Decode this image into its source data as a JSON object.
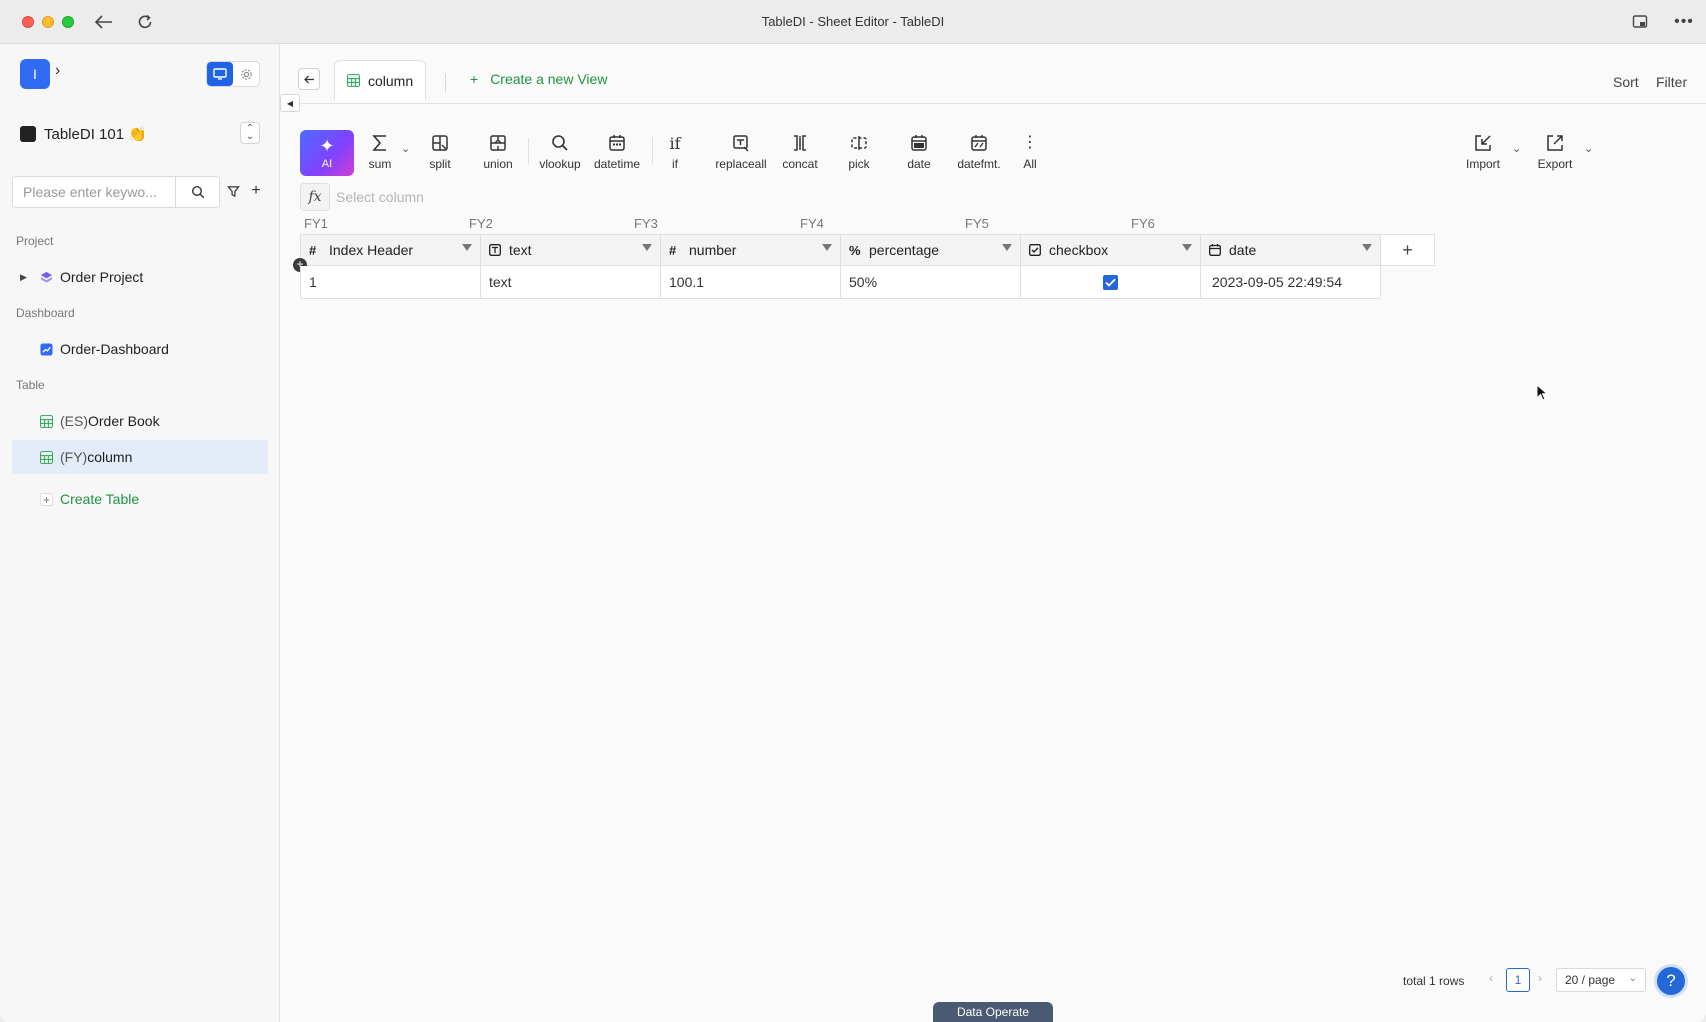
{
  "window": {
    "title": "TableDI - Sheet Editor - TableDI"
  },
  "sidebar": {
    "logo_letter": "I",
    "workspace": {
      "name": "TableDI 101 👏"
    },
    "search": {
      "placeholder": "Please enter keywo..."
    },
    "sections": {
      "project": "Project",
      "dashboard": "Dashboard",
      "table": "Table"
    },
    "items": {
      "order_project": "Order Project",
      "order_dashboard": "Order-Dashboard",
      "order_book": {
        "prefix": "(ES)",
        "label": "Order Book"
      },
      "column": {
        "prefix": "(FY)",
        "label": "column"
      },
      "create_table": "Create Table"
    }
  },
  "tabs": {
    "active": "column",
    "new_view": "Create a new View",
    "sort": "Sort",
    "filter": "Filter"
  },
  "toolbar": {
    "ai": "AI",
    "sum": "sum",
    "split": "split",
    "union": "union",
    "vlookup": "vlookup",
    "datetime": "datetime",
    "if": "if",
    "replaceall": "replaceall",
    "concat": "concat",
    "pick": "pick",
    "date": "date",
    "datefmt": "datefmt.",
    "all": "All",
    "import": "Import",
    "export": "Export"
  },
  "formula": {
    "fx": "fx",
    "placeholder": "Select column"
  },
  "grid": {
    "column_ids": [
      "FY1",
      "FY2",
      "FY3",
      "FY4",
      "FY5",
      "FY6"
    ],
    "headers": [
      {
        "icon": "hash-icon",
        "label": "Index Header"
      },
      {
        "icon": "text-icon",
        "label": "text"
      },
      {
        "icon": "hash-icon",
        "label": "number"
      },
      {
        "icon": "percent-icon",
        "label": "percentage"
      },
      {
        "icon": "checkbox-icon",
        "label": "checkbox"
      },
      {
        "icon": "calendar-icon",
        "label": "date"
      }
    ],
    "add_column": "+",
    "rows": [
      {
        "index": "1",
        "text": "text",
        "number": "100.1",
        "percentage": "50%",
        "checkbox": true,
        "date": "2023-09-05 22:49:54"
      }
    ]
  },
  "pagination": {
    "total": "total 1 rows",
    "page": "1",
    "page_size": "20 / page"
  },
  "help": "?",
  "data_operate": "Data Operate",
  "colors": {
    "accent": "#2367d9",
    "green": "#1f9242",
    "ai_start": "#4f6cff",
    "ai_end": "#d13bd6"
  }
}
